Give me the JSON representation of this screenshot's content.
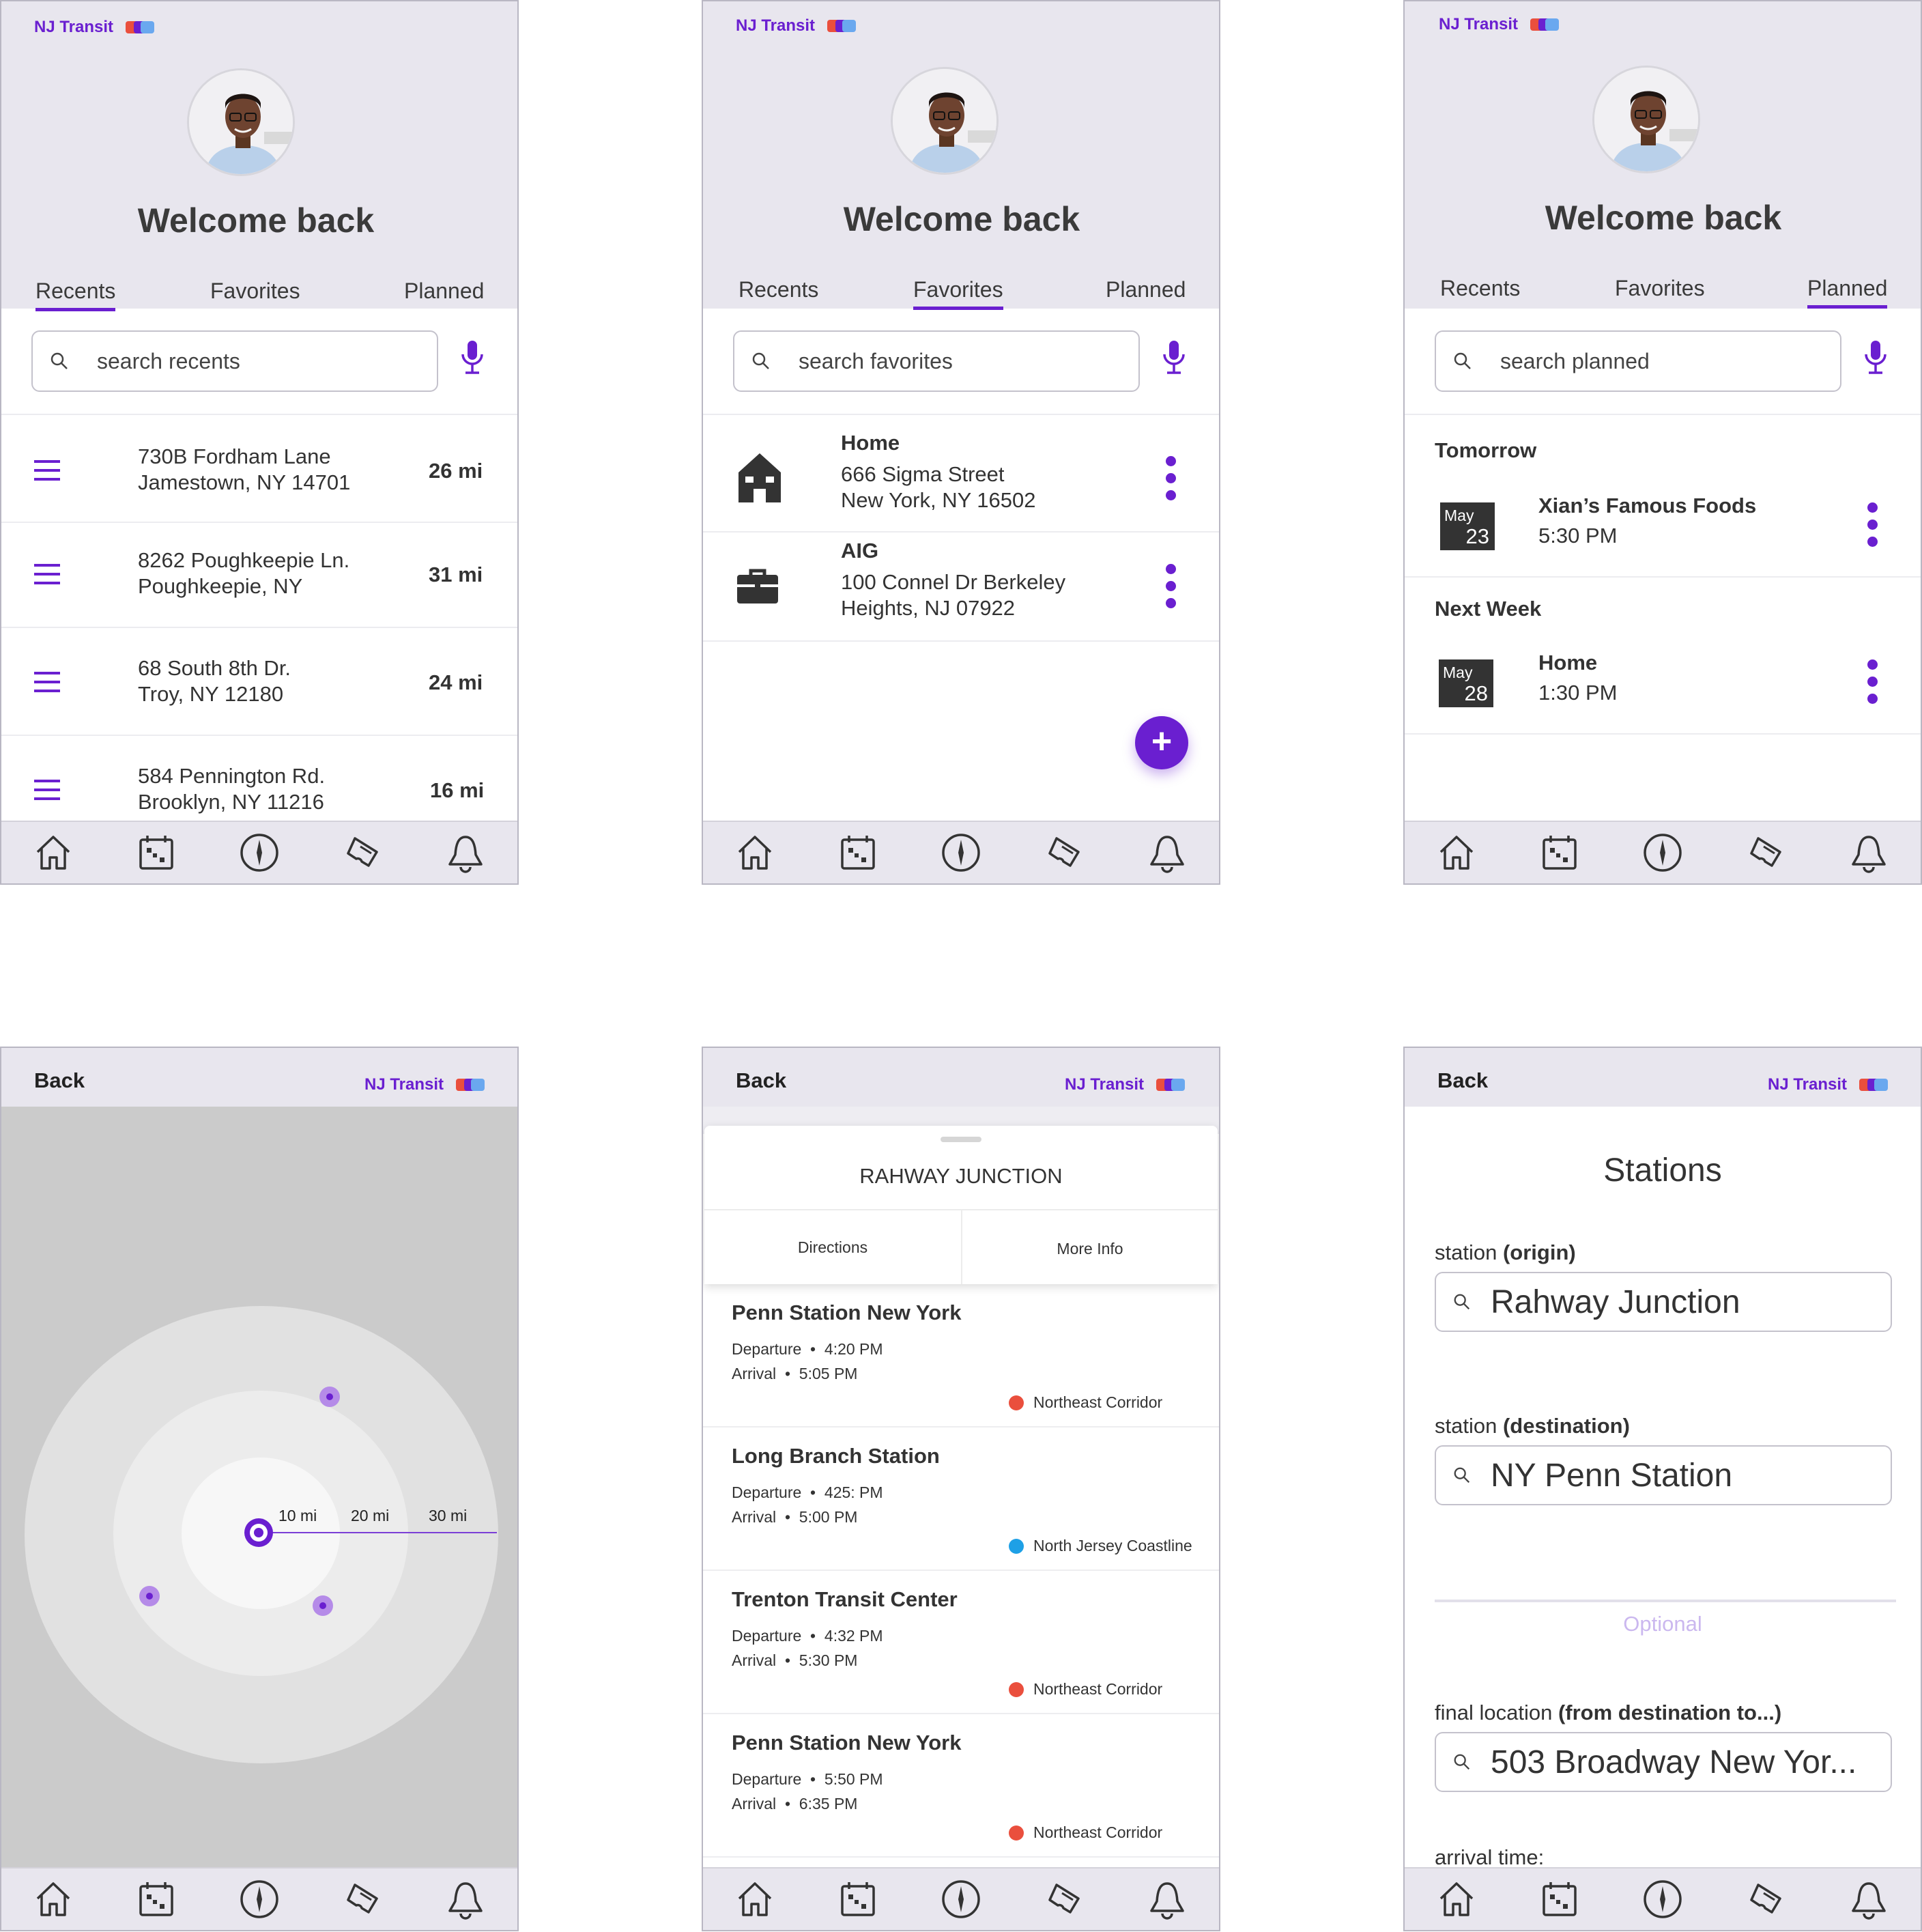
{
  "colors": {
    "accent": "#6a1fd0",
    "header_bg": "#e8e6ee",
    "northeast_corridor": "#ea4f3d",
    "north_jersey_coastline": "#1ea0e6"
  },
  "brand": "NJ Transit",
  "welcome": "Welcome back",
  "tabs": [
    "Recents",
    "Favorites",
    "Planned"
  ],
  "nav_icons": [
    "home-icon",
    "calendar-icon",
    "compass-icon",
    "ticket-icon",
    "bell-icon"
  ],
  "recents": {
    "search_placeholder": "search recents",
    "items": [
      {
        "line1": "730B Fordham Lane",
        "line2": "Jamestown, NY 14701",
        "distance": "26 mi"
      },
      {
        "line1": "8262 Poughkeepie Ln.",
        "line2": "Poughkeepie, NY",
        "distance": "31 mi"
      },
      {
        "line1": "68 South 8th Dr.",
        "line2": "Troy, NY 12180",
        "distance": "24 mi"
      },
      {
        "line1": "584 Pennington Rd.",
        "line2": "Brooklyn, NY 11216",
        "distance": "16 mi"
      }
    ]
  },
  "favorites": {
    "search_placeholder": "search favorites",
    "items": [
      {
        "title": "Home",
        "line1": "666 Sigma Street",
        "line2": "New York, NY 16502",
        "icon": "house-icon"
      },
      {
        "title": "AIG",
        "line1": "100 Connel Dr Berkeley",
        "line2": "Heights, NJ 07922",
        "icon": "briefcase-icon"
      }
    ],
    "fab": "+"
  },
  "planned": {
    "search_placeholder": "search planned",
    "groups": [
      {
        "label": "Tomorrow",
        "month": "May",
        "day": "23",
        "title": "Xian’s Famous Foods",
        "time": "5:30 PM"
      },
      {
        "label": "Next Week",
        "month": "May",
        "day": "28",
        "title": "Home",
        "time": "1:30 PM"
      }
    ]
  },
  "map": {
    "back": "Back",
    "rings": [
      "10 mi",
      "20 mi",
      "30 mi"
    ]
  },
  "station": {
    "back": "Back",
    "name": "RAHWAY JUNCTION",
    "actions": [
      "Directions",
      "More Info"
    ],
    "trips": [
      {
        "dest": "Penn Station New York",
        "dep_label": "Departure",
        "dep": "4:20 PM",
        "arr_label": "Arrival",
        "arr": "5:05 PM",
        "line": "Northeast Corridor",
        "line_color": "#ea4f3d"
      },
      {
        "dest": "Long Branch Station",
        "dep_label": "Departure",
        "dep": "425: PM",
        "arr_label": "Arrival",
        "arr": "5:00 PM",
        "line": "North Jersey Coastline",
        "line_color": "#1ea0e6"
      },
      {
        "dest": "Trenton Transit Center",
        "dep_label": "Departure",
        "dep": "4:32 PM",
        "arr_label": "Arrival",
        "arr": "5:30 PM",
        "line": "Northeast Corridor",
        "line_color": "#ea4f3d"
      },
      {
        "dest": "Penn Station New York",
        "dep_label": "Departure",
        "dep": "5:50 PM",
        "arr_label": "Arrival",
        "arr": "6:35 PM",
        "line": "Northeast Corridor",
        "line_color": "#ea4f3d"
      }
    ]
  },
  "stations_form": {
    "back": "Back",
    "title": "Stations",
    "origin_label": "station ",
    "origin_label_bold": "(origin)",
    "origin_value": "Rahway Junction",
    "dest_label": "station ",
    "dest_label_bold": "(destination)",
    "dest_value": "NY Penn Station",
    "optional": "Optional",
    "final_label": "final location ",
    "final_label_bold": "(from destination to...)",
    "final_value": "503 Broadway New Yor...",
    "arrival_label": "arrival time:"
  }
}
